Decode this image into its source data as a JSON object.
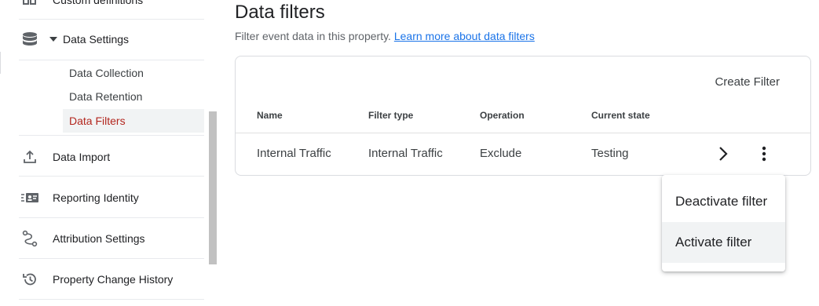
{
  "sidebar": {
    "custom_definitions": "Custom definitions",
    "data_settings": "Data Settings",
    "sub_items": [
      "Data Collection",
      "Data Retention",
      "Data Filters"
    ],
    "data_import": "Data Import",
    "reporting_identity": "Reporting Identity",
    "attribution_settings": "Attribution Settings",
    "property_change_history": "Property Change History"
  },
  "main": {
    "title": "Data filters",
    "subtitle": "Filter event data in this property.",
    "learn_more": "Learn more about data filters",
    "create_filter": "Create Filter",
    "table": {
      "headers": [
        "Name",
        "Filter type",
        "Operation",
        "Current state"
      ],
      "rows": [
        [
          "Internal Traffic",
          "Internal Traffic",
          "Exclude",
          "Testing"
        ]
      ]
    }
  },
  "menu": {
    "items": [
      "Deactivate filter",
      "Activate filter"
    ]
  },
  "colors": {
    "accent_red": "#b3261e",
    "link_blue": "#1a73e8",
    "hover_bg": "#f1f3f4"
  }
}
